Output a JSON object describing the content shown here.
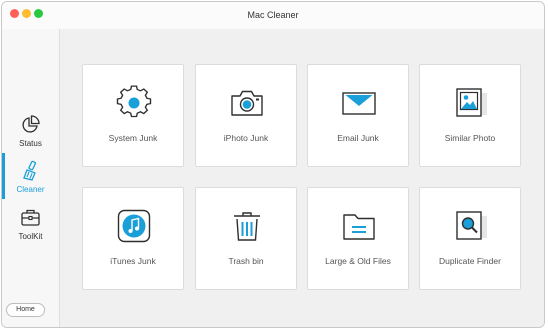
{
  "window": {
    "title": "Mac Cleaner",
    "traffic_lights": {
      "close_color": "#ff5f57",
      "minimize_color": "#febc2e",
      "zoom_color": "#28c840"
    }
  },
  "sidebar": {
    "items": [
      {
        "label": "Status",
        "icon": "pie-chart-icon",
        "active": false
      },
      {
        "label": "Cleaner",
        "icon": "broom-icon",
        "active": true
      },
      {
        "label": "ToolKit",
        "icon": "toolbox-icon",
        "active": false
      }
    ],
    "home_label": "Home"
  },
  "main": {
    "cards": [
      {
        "label": "System Junk",
        "icon": "gear-icon"
      },
      {
        "label": "iPhoto Junk",
        "icon": "camera-icon"
      },
      {
        "label": "Email Junk",
        "icon": "envelope-icon"
      },
      {
        "label": "Similar Photo",
        "icon": "photo-icon"
      },
      {
        "label": "iTunes Junk",
        "icon": "music-note-icon"
      },
      {
        "label": "Trash bin",
        "icon": "trash-icon"
      },
      {
        "label": "Large & Old Files",
        "icon": "folder-icon"
      },
      {
        "label": "Duplicate Finder",
        "icon": "magnifier-document-icon"
      }
    ]
  },
  "theme": {
    "accent": "#1a9fd9",
    "icon_stroke": "#2f2f2f"
  }
}
